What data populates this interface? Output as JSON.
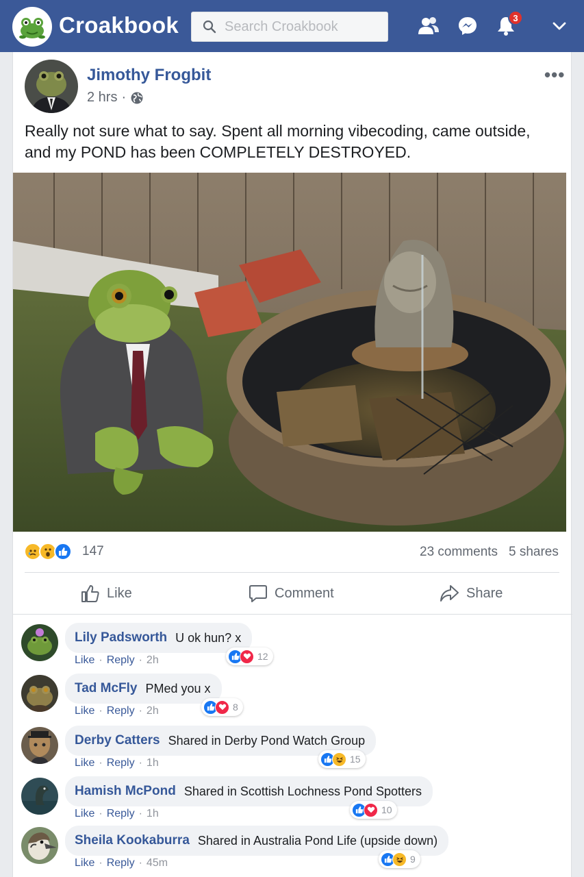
{
  "app": {
    "name": "Croakbook"
  },
  "search": {
    "placeholder": "Search Croakbook"
  },
  "nav": {
    "notifications_count": "3"
  },
  "post": {
    "author": "Jimothy Frogbit",
    "time": "2 hrs",
    "separator": "·",
    "text": "Really not sure what to say. Spent all morning vibecoding, came outside, and my POND has been COMPLETELY DESTROYED.",
    "reaction_count": "147",
    "reaction_types": [
      "sad",
      "wow",
      "like"
    ],
    "comments_count": "23 comments",
    "shares_count": "5 shares",
    "actions": {
      "like": "Like",
      "comment": "Comment",
      "share": "Share"
    }
  },
  "comments": [
    {
      "name": "Lily Padsworth",
      "text": "U ok hun? x",
      "like": "Like",
      "reply": "Reply",
      "time": "2h",
      "reactions": [
        "like",
        "love"
      ],
      "reaction_count": "12"
    },
    {
      "name": "Tad McFly",
      "text": "PMed you x",
      "like": "Like",
      "reply": "Reply",
      "time": "2h",
      "reactions": [
        "like",
        "love"
      ],
      "reaction_count": "8"
    },
    {
      "name": "Derby Catters",
      "text": "Shared in Derby Pond Watch Group",
      "like": "Like",
      "reply": "Reply",
      "time": "1h",
      "reactions": [
        "like",
        "haha"
      ],
      "reaction_count": "15"
    },
    {
      "name": "Hamish McPond",
      "text": "Shared in Scottish Lochness Pond Spotters",
      "like": "Like",
      "reply": "Reply",
      "time": "1h",
      "reactions": [
        "like",
        "love"
      ],
      "reaction_count": "10"
    },
    {
      "name": "Sheila Kookaburra",
      "text": "Shared in Australia Pond Life (upside down)",
      "like": "Like",
      "reply": "Reply",
      "time": "45m",
      "reactions": [
        "like",
        "haha"
      ],
      "reaction_count": "9"
    }
  ],
  "colors": {
    "brand": "#3b5998",
    "link": "#365899",
    "like": "#1877f2",
    "love": "#f02849",
    "reaction_yellow": "#f7b928"
  }
}
